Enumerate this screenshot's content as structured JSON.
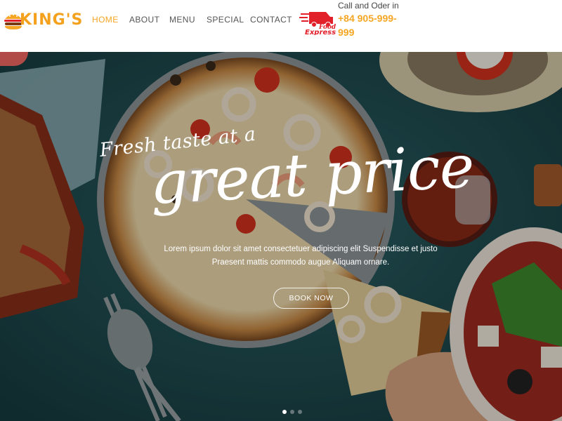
{
  "brand": {
    "name": "KING'S"
  },
  "nav": {
    "items": [
      {
        "label": "HOME",
        "active": true
      },
      {
        "label": "ABOUT",
        "active": false
      },
      {
        "label": "MENU",
        "active": false
      },
      {
        "label": "SPECIAL",
        "active": false
      },
      {
        "label": "CONTACT",
        "active": false
      }
    ]
  },
  "express_logo": {
    "line1": "Food",
    "line2": "Express"
  },
  "contact": {
    "label": "Call and Oder in",
    "phone": "+84 905-999-999"
  },
  "hero": {
    "tagline": "Fresh taste at a",
    "headline": "great price",
    "body_line1": "Lorem ipsum dolor sit amet consectetuer adipiscing elit Suspendisse et justo",
    "body_line2": "Praesent mattis commodo augue Aliquam ornare.",
    "button_label": "BOOK NOW",
    "slides": 3,
    "active_slide": 1
  },
  "colors": {
    "accent": "#f5a623",
    "express_red": "#e2202a",
    "table": "#1f4c50"
  },
  "icons": [
    "burger-logo-icon",
    "food-express-logo-icon"
  ]
}
